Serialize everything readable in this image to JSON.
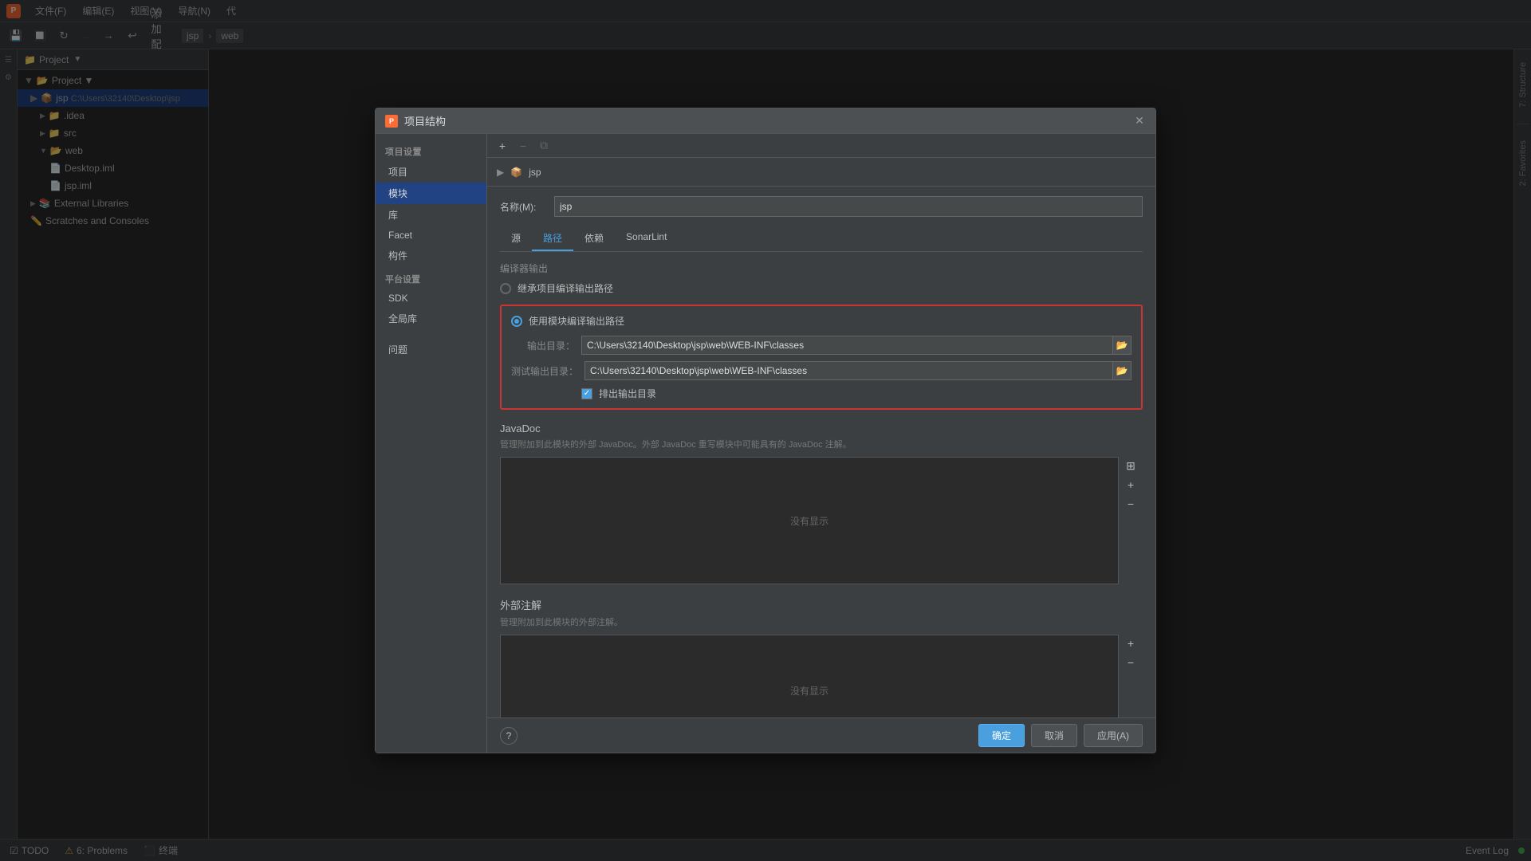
{
  "app": {
    "title": "项目结构",
    "logo": "P"
  },
  "menubar": {
    "items": [
      "文件(F)",
      "编辑(E)",
      "视图(V)",
      "导航(N)",
      "代"
    ]
  },
  "toolbar": {
    "add_config_label": "添加配置...",
    "project_label": "jsp",
    "project_label2": "web"
  },
  "project_panel": {
    "header": "Project",
    "tree_items": [
      {
        "label": "Project ▼",
        "level": 0,
        "icon": "project"
      },
      {
        "label": "jsp C:\\Users\\32140\\Desktop\\jsp",
        "level": 1,
        "icon": "module",
        "selected": true
      },
      {
        "label": ".idea",
        "level": 2,
        "icon": "folder"
      },
      {
        "label": "src",
        "level": 2,
        "icon": "folder"
      },
      {
        "label": "web",
        "level": 2,
        "icon": "folder-open"
      },
      {
        "label": "Desktop.iml",
        "level": 3,
        "icon": "file"
      },
      {
        "label": "jsp.iml",
        "level": 3,
        "icon": "file"
      },
      {
        "label": "External Libraries",
        "level": 1,
        "icon": "library"
      },
      {
        "label": "Scratches and Consoles",
        "level": 1,
        "icon": "scratches"
      }
    ]
  },
  "dialog": {
    "title": "项目结构",
    "nav": {
      "project_settings_header": "项目设置",
      "items_project": [
        "项目",
        "模块",
        "库",
        "Facet",
        "构件"
      ],
      "platform_header": "平台设置",
      "items_platform": [
        "SDK",
        "全局库"
      ],
      "items_other": [
        "问题"
      ]
    },
    "selected_nav": "模块",
    "toolbar": {
      "add_btn": "+",
      "remove_btn": "−",
      "copy_btn": "⧉"
    },
    "module_tree": {
      "item": "jsp"
    },
    "form": {
      "name_label": "名称(M):",
      "name_value": "jsp",
      "tabs": [
        "源",
        "路径",
        "依赖",
        "SonarLint"
      ],
      "active_tab": "路径",
      "compiler_output_label": "编译器输出",
      "radio1_label": "继承项目编译输出路径",
      "radio2_label": "使用模块编译输出路径",
      "output_label": "输出目录：",
      "output_value": "C:\\Users\\32140\\Desktop\\jsp\\web\\WEB-INF\\classes",
      "test_output_label": "测试输出目录：",
      "test_output_value": "C:\\Users\\32140\\Desktop\\jsp\\web\\WEB-INF\\classes",
      "checkbox_label": "排出输出目录",
      "javadoc_title": "JavaDoc",
      "javadoc_desc": "管理附加到此模块的外部 JavaDoc。外部 JavaDoc 重写模块中可能具有的 JavaDoc 注解。",
      "javadoc_empty": "没有显示",
      "ext_annotation_title": "外部注解",
      "ext_annotation_desc": "管理附加到此模块的外部注解。",
      "ext_annotation_empty": "没有显示"
    },
    "footer": {
      "ok_label": "确定",
      "cancel_label": "取消",
      "apply_label": "应用(A)"
    }
  },
  "statusbar": {
    "todo_label": "TODO",
    "problems_label": "6: Problems",
    "terminal_label": "终端",
    "event_log_label": "Event Log"
  },
  "right_panel": {
    "structure_label": "7: Structure",
    "favorites_label": "2: Favorites"
  }
}
